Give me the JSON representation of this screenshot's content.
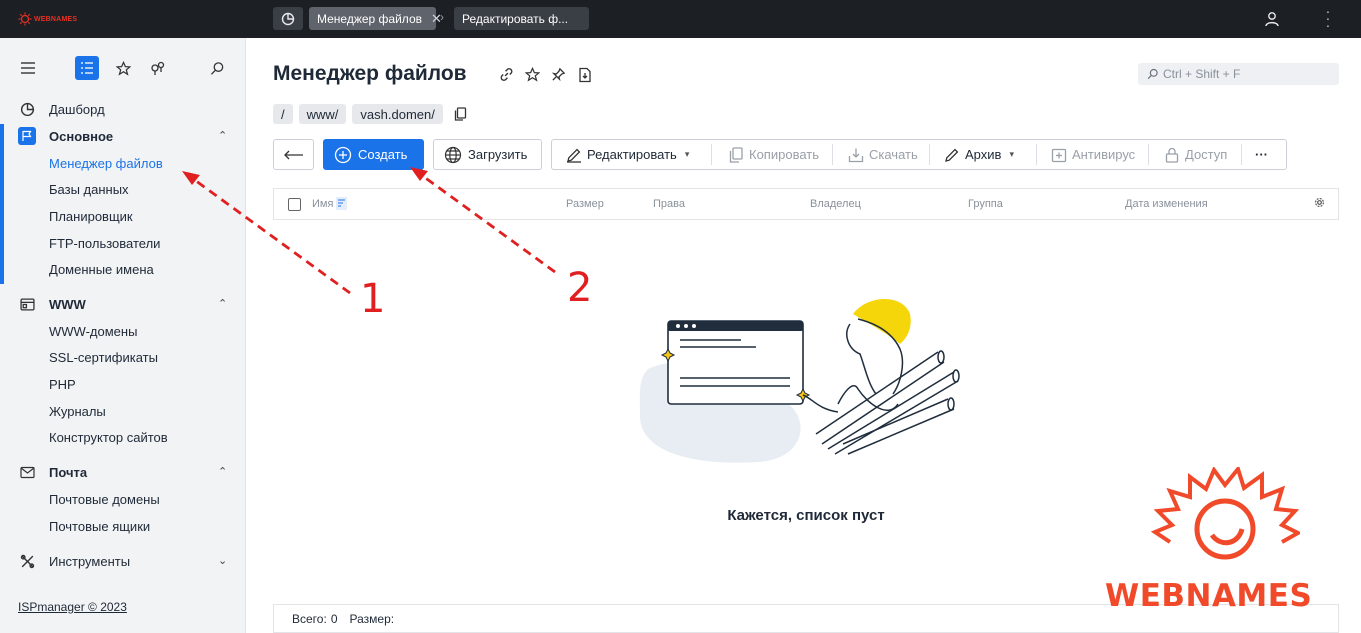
{
  "top_bar": {
    "logo_text": "WEBNAMES",
    "tabs": [
      {
        "label": "Менеджер файлов",
        "active": true
      },
      {
        "label": "Редактировать ф...",
        "active": false
      }
    ]
  },
  "sidebar": {
    "groups": [
      {
        "label": "Дашборд",
        "icon": "dashboard-icon",
        "items": []
      },
      {
        "label": "Основное",
        "icon": "flag-icon",
        "items": [
          "Менеджер файлов",
          "Базы данных",
          "Планировщик",
          "FTP-пользователи",
          "Доменные имена"
        ]
      },
      {
        "label": "WWW",
        "icon": "www-icon",
        "items": [
          "WWW-домены",
          "SSL-сертификаты",
          "PHP",
          "Журналы",
          "Конструктор сайтов"
        ]
      },
      {
        "label": "Почта",
        "icon": "mail-icon",
        "items": [
          "Почтовые домены",
          "Почтовые ящики"
        ]
      },
      {
        "label": "Инструменты",
        "icon": "tools-icon",
        "items": []
      }
    ],
    "footer": "ISPmanager © 2023"
  },
  "page": {
    "title": "Менеджер файлов",
    "search_placeholder": "Ctrl + Shift + F",
    "breadcrumbs": [
      "/",
      "www/",
      "vash.domen/"
    ]
  },
  "toolbar": {
    "create": "Создать",
    "upload": "Загрузить",
    "edit": "Редактировать",
    "copy": "Копировать",
    "download": "Скачать",
    "archive": "Архив",
    "antivirus": "Антивирус",
    "access": "Доступ",
    "more": "···"
  },
  "table": {
    "columns": [
      "Имя",
      "Размер",
      "Права",
      "Владелец",
      "Группа",
      "Дата изменения"
    ]
  },
  "empty_state": "Кажется, список пуст",
  "footer": {
    "total_label": "Всего:",
    "total_value": "0",
    "size_label": "Размер:"
  },
  "annotations": [
    "1",
    "2"
  ],
  "brand": "WEBNAMES",
  "colors": {
    "accent": "#1a73e8",
    "annotation": "#e02020",
    "brand": "#f04a2a",
    "topbar": "#1c1f24"
  }
}
